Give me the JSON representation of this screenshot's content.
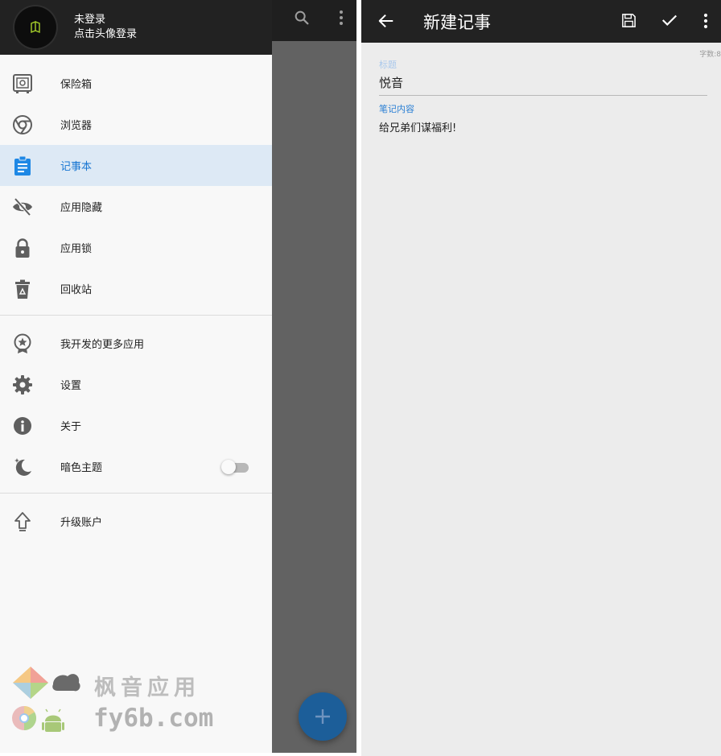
{
  "drawer": {
    "user_name": "未登录",
    "user_subtitle": "点击头像登录",
    "items": [
      {
        "label": "保险箱",
        "icon": "safe-icon"
      },
      {
        "label": "浏览器",
        "icon": "chrome-icon"
      },
      {
        "label": "记事本",
        "icon": "clipboard-icon",
        "active": true
      },
      {
        "label": "应用隐藏",
        "icon": "eye-off-icon"
      },
      {
        "label": "应用锁",
        "icon": "lock-icon"
      },
      {
        "label": "回收站",
        "icon": "recycle-bin-icon"
      },
      {
        "label": "我开发的更多应用",
        "icon": "badge-star-icon"
      },
      {
        "label": "设置",
        "icon": "gear-icon"
      },
      {
        "label": "关于",
        "icon": "info-icon"
      },
      {
        "label": "暗色主题",
        "icon": "moon-icon",
        "toggle": false
      },
      {
        "label": "升级账户",
        "icon": "upgrade-arrow-icon"
      }
    ]
  },
  "watermark": {
    "brand": "枫音应用",
    "url": "fy6b.com"
  },
  "editor": {
    "title": "新建记事",
    "char_count": "字数:8",
    "title_label": "标题",
    "title_value": "悦音",
    "content_label": "笔记内容",
    "content_value": "给兄弟们谋福利!"
  },
  "colors": {
    "accent": "#1976d2",
    "active_row": "#dde9f5",
    "toolbar": "#222222",
    "fab": "#1c5e99"
  }
}
